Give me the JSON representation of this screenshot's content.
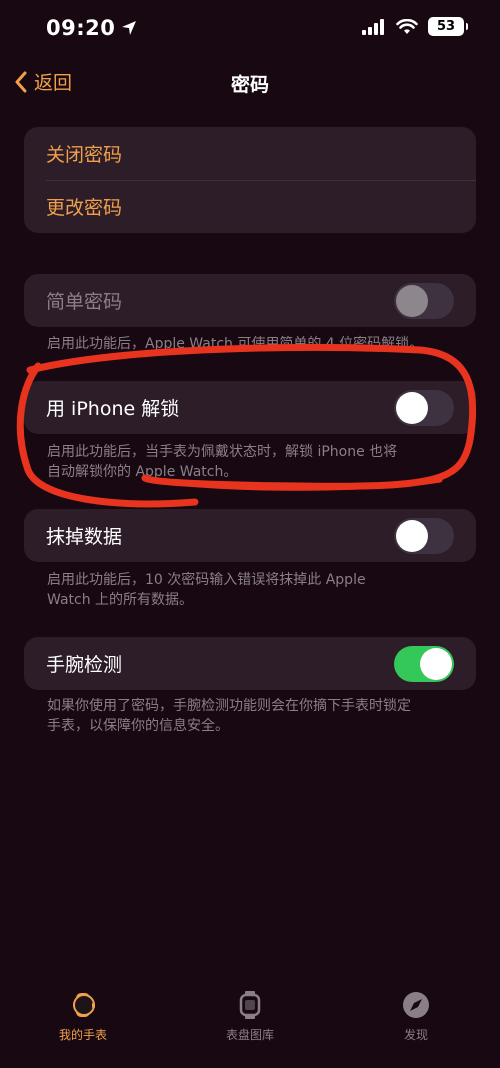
{
  "status_bar": {
    "time": "09:20",
    "battery": "53"
  },
  "nav": {
    "back_label": "返回",
    "title": "密码"
  },
  "group1": {
    "turn_off": "关闭密码",
    "change": "更改密码"
  },
  "simple_passcode": {
    "label": "简单密码",
    "enabled": false,
    "footnote": "启用此功能后，Apple Watch 可使用简单的 4 位密码解锁。"
  },
  "unlock_iphone": {
    "label": "用 iPhone 解锁",
    "enabled": false,
    "footnote_line1": "启用此功能后，当手表为佩戴状态时，解锁 iPhone 也将",
    "footnote_line2": "自动解锁你的 Apple Watch。"
  },
  "erase_data": {
    "label": "抹掉数据",
    "enabled": false,
    "footnote_line1": "启用此功能后，10 次密码输入错误将抹掉此 Apple",
    "footnote_line2": "Watch 上的所有数据。"
  },
  "wrist_detection": {
    "label": "手腕检测",
    "enabled": true,
    "footnote_line1": "如果你使用了密码，手腕检测功能则会在你摘下手表时锁定",
    "footnote_line2": "手表，以保障你的信息安全。"
  },
  "tabs": [
    {
      "label": "我的手表",
      "icon": "watch-icon",
      "active": true
    },
    {
      "label": "表盘图库",
      "icon": "watch-face-icon",
      "active": false
    },
    {
      "label": "发现",
      "icon": "compass-icon",
      "active": false
    }
  ],
  "colors": {
    "accent": "#f0a04a",
    "background": "#170812",
    "toggle_on": "#34c759",
    "annotation": "#e8331e"
  }
}
